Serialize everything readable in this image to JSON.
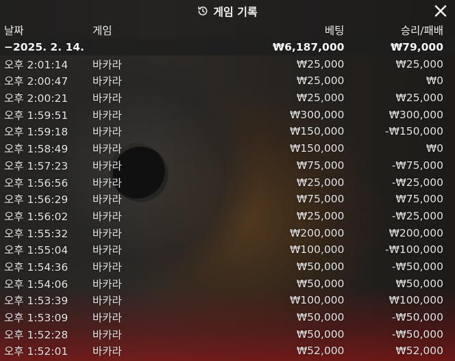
{
  "dialog": {
    "title": "게임 기록"
  },
  "columns": {
    "date": "날짜",
    "game": "게임",
    "bet": "베팅",
    "result": "승리/패배"
  },
  "summary": {
    "date": "−2025. 2. 14.",
    "game": "",
    "bet": "₩6,187,000",
    "result": "₩79,000"
  },
  "rows": [
    {
      "time": "오후 2:01:14",
      "game": "바카라",
      "bet": "₩25,000",
      "result": "₩25,000"
    },
    {
      "time": "오후 2:00:47",
      "game": "바카라",
      "bet": "₩25,000",
      "result": "₩0"
    },
    {
      "time": "오후 2:00:21",
      "game": "바카라",
      "bet": "₩25,000",
      "result": "₩25,000"
    },
    {
      "time": "오후 1:59:51",
      "game": "바카라",
      "bet": "₩300,000",
      "result": "₩300,000"
    },
    {
      "time": "오후 1:59:18",
      "game": "바카라",
      "bet": "₩150,000",
      "result": "-₩150,000"
    },
    {
      "time": "오후 1:58:49",
      "game": "바카라",
      "bet": "₩150,000",
      "result": "₩0"
    },
    {
      "time": "오후 1:57:23",
      "game": "바카라",
      "bet": "₩75,000",
      "result": "-₩75,000"
    },
    {
      "time": "오후 1:56:56",
      "game": "바카라",
      "bet": "₩25,000",
      "result": "-₩25,000"
    },
    {
      "time": "오후 1:56:29",
      "game": "바카라",
      "bet": "₩75,000",
      "result": "₩75,000"
    },
    {
      "time": "오후 1:56:02",
      "game": "바카라",
      "bet": "₩25,000",
      "result": "-₩25,000"
    },
    {
      "time": "오후 1:55:32",
      "game": "바카라",
      "bet": "₩200,000",
      "result": "₩200,000"
    },
    {
      "time": "오후 1:55:04",
      "game": "바카라",
      "bet": "₩100,000",
      "result": "-₩100,000"
    },
    {
      "time": "오후 1:54:36",
      "game": "바카라",
      "bet": "₩50,000",
      "result": "-₩50,000"
    },
    {
      "time": "오후 1:54:06",
      "game": "바카라",
      "bet": "₩50,000",
      "result": "₩50,000"
    },
    {
      "time": "오후 1:53:39",
      "game": "바카라",
      "bet": "₩100,000",
      "result": "₩100,000"
    },
    {
      "time": "오후 1:53:09",
      "game": "바카라",
      "bet": "₩50,000",
      "result": "-₩50,000"
    },
    {
      "time": "오후 1:52:28",
      "game": "바카라",
      "bet": "₩50,000",
      "result": "-₩50,000"
    },
    {
      "time": "오후 1:52:01",
      "game": "바카라",
      "bet": "₩52,000",
      "result": "₩52,000"
    }
  ],
  "icons": {
    "history": "history-icon",
    "close": "close-icon"
  }
}
